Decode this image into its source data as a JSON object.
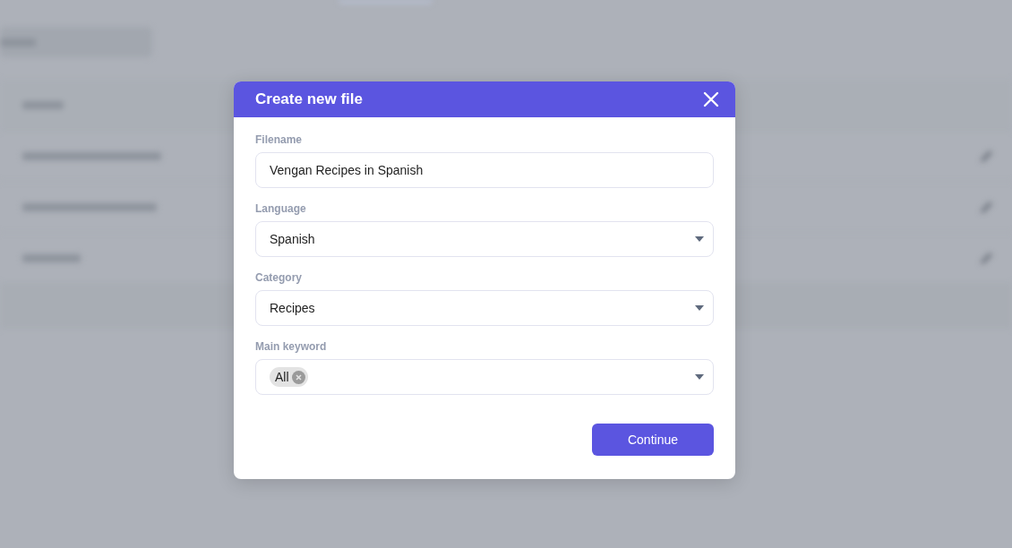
{
  "background": {
    "rows": [
      {},
      {},
      {}
    ]
  },
  "dialog": {
    "title": "Create new file",
    "fields": [
      {
        "kind": "text",
        "label": "Filename",
        "value": "Vengan Recipes in Spanish"
      },
      {
        "kind": "select",
        "label": "Language",
        "value": "Spanish"
      },
      {
        "kind": "select",
        "label": "Category",
        "value": "Recipes"
      },
      {
        "kind": "tags",
        "label": "Main keyword",
        "tags": [
          "All"
        ]
      }
    ],
    "button": "Continue"
  }
}
